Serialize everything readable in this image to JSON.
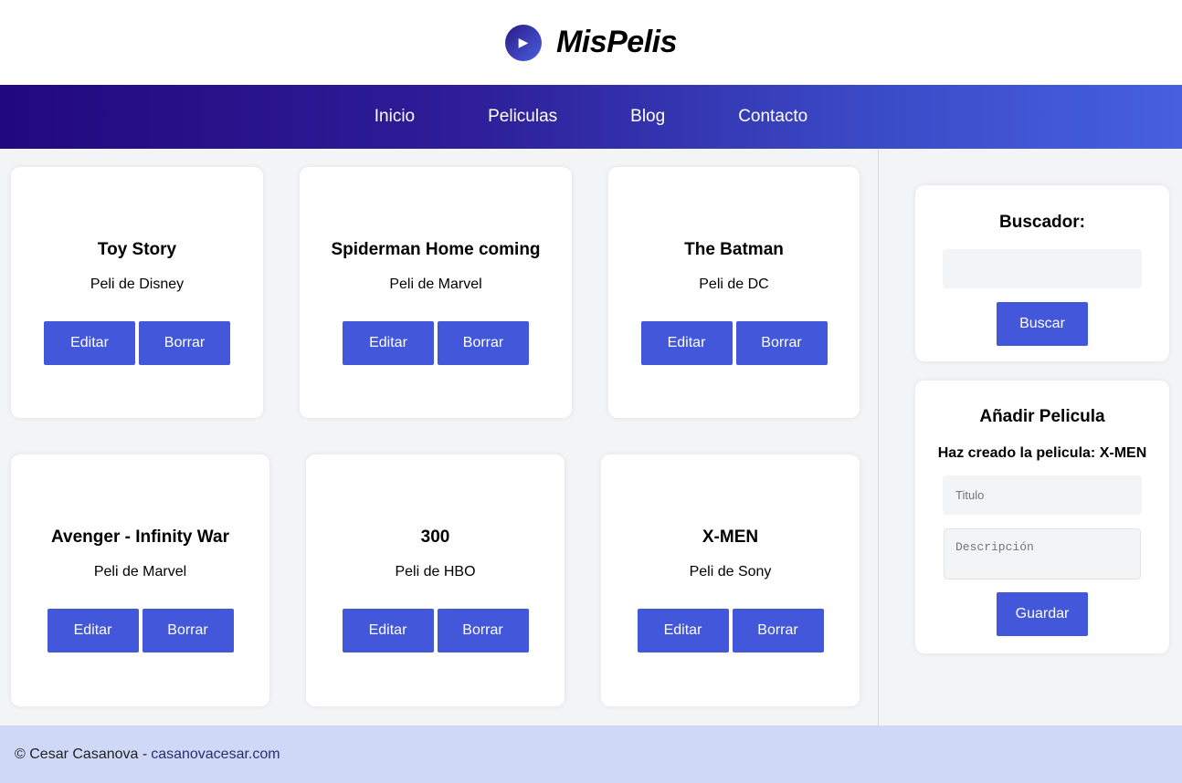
{
  "brand": {
    "title": "MisPelis",
    "icon": "play-icon"
  },
  "nav": {
    "items": [
      "Inicio",
      "Peliculas",
      "Blog",
      "Contacto"
    ]
  },
  "movies": [
    {
      "title": "Toy Story",
      "description": "Peli de Disney",
      "edit_label": "Editar",
      "delete_label": "Borrar"
    },
    {
      "title": "Spiderman Home coming",
      "description": "Peli de Marvel",
      "edit_label": "Editar",
      "delete_label": "Borrar"
    },
    {
      "title": "The Batman",
      "description": "Peli de DC",
      "edit_label": "Editar",
      "delete_label": "Borrar"
    },
    {
      "title": "Avenger - Infinity War",
      "description": "Peli de Marvel",
      "edit_label": "Editar",
      "delete_label": "Borrar"
    },
    {
      "title": "300",
      "description": "Peli de HBO",
      "edit_label": "Editar",
      "delete_label": "Borrar"
    },
    {
      "title": "X-MEN",
      "description": "Peli de Sony",
      "edit_label": "Editar",
      "delete_label": "Borrar"
    }
  ],
  "search": {
    "title": "Buscador:",
    "value": "",
    "button_label": "Buscar"
  },
  "add_movie": {
    "title": "Añadir Pelicula",
    "created_message": "Haz creado la pelicula: X-MEN",
    "title_placeholder": "Titulo",
    "description_placeholder": "Descripción",
    "button_label": "Guardar"
  },
  "footer": {
    "copyright": "© Cesar Casanova -",
    "link_text": "casanovacesar.com"
  },
  "colors": {
    "accent": "#4257d9",
    "nav_start": "#22087e",
    "nav_end": "#4660df",
    "footer_bg": "#cfd8f7"
  }
}
